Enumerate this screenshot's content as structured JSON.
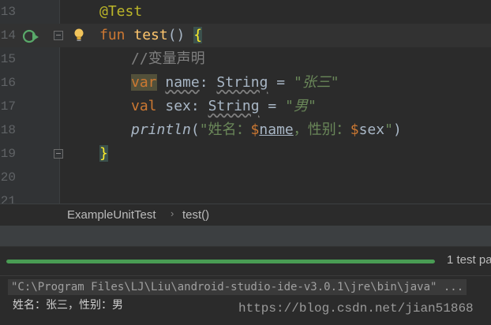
{
  "editor": {
    "lines": [
      {
        "num": "13"
      },
      {
        "num": "14"
      },
      {
        "num": "15"
      },
      {
        "num": "16"
      },
      {
        "num": "17"
      },
      {
        "num": "18"
      },
      {
        "num": "19"
      },
      {
        "num": "20"
      },
      {
        "num": "21"
      }
    ],
    "code": {
      "l13": {
        "annotation": "@Test"
      },
      "l14": {
        "kw": "fun",
        "name": "test",
        "parens": "()",
        "brace": "{"
      },
      "l15": {
        "comment": "//变量声明"
      },
      "l16": {
        "kw": "var",
        "ident": "name",
        "colon": ": ",
        "type": "String",
        "eq": " = ",
        "str": "\"张三\""
      },
      "l17": {
        "kw": "val",
        "ident": "sex",
        "colon": ": ",
        "type": "String",
        "eq": " = ",
        "str": "\"男\""
      },
      "l18": {
        "fn": "println",
        "open": "(",
        "s1": "\"姓名：",
        "d1": "$",
        "v1": "name",
        "s2": "，性别：",
        "d2": "$",
        "v2": "sex",
        "s3": "\"",
        "close": ")"
      },
      "l19": {
        "brace": "}"
      }
    },
    "icons": {
      "run": "run-test-icon",
      "bulb": "intention-bulb-icon"
    }
  },
  "breadcrumb": {
    "class_name": "ExampleUnitTest",
    "separator": "›",
    "method": "test()"
  },
  "run": {
    "progress_percent": 100,
    "status": "1 test pa",
    "color": "#499c54"
  },
  "console": {
    "command": "\"C:\\Program Files\\LJ\\Liu\\android-studio-ide-v3.0.1\\jre\\bin\\java\" ...",
    "output": "姓名：张三，性别：男",
    "watermark": "https://blog.csdn.net/jian51868"
  }
}
